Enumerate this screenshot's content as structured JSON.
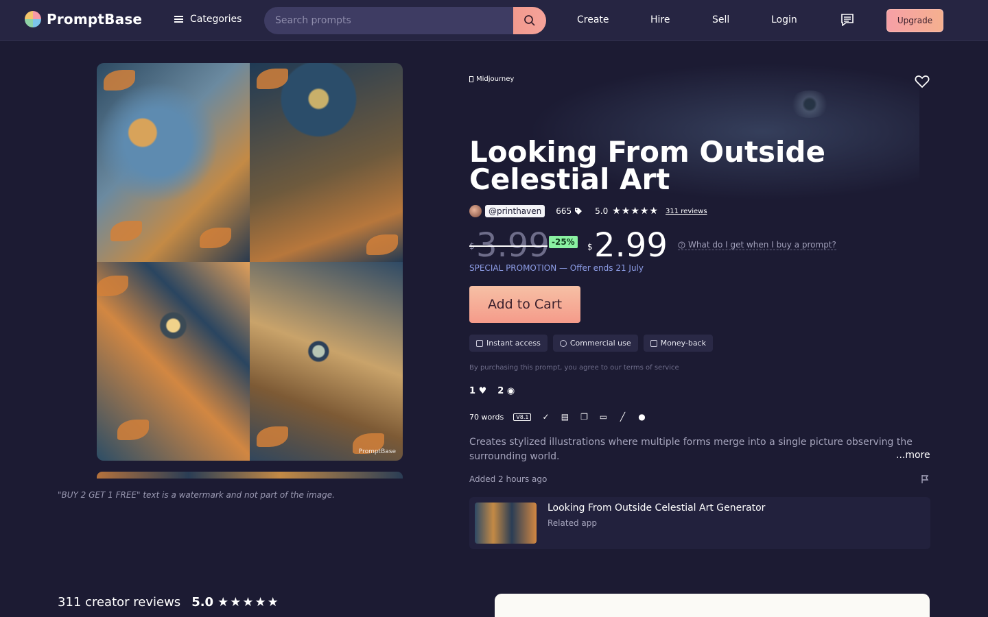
{
  "nav": {
    "brand": "PromptBase",
    "categories_label": "Categories",
    "search_placeholder": "Search prompts",
    "links": [
      "Create",
      "Hire",
      "Sell",
      "Login"
    ],
    "upgrade_label": "Upgrade"
  },
  "gallery": {
    "watermark": "PromptBase",
    "caption": "\"BUY 2 GET 1 FREE\" text is a watermark and not part of the image."
  },
  "product": {
    "model": "Midjourney",
    "title": "Looking From Outside Celestial Art",
    "seller": "@printhaven",
    "sales": "665",
    "rating": "5.0",
    "stars": "★★★★★",
    "reviews_link": "311 reviews",
    "old_currency": "$",
    "old_price": "3.99",
    "discount": "-25%",
    "currency": "$",
    "price": "2.99",
    "what_link": "What do I get when I buy a prompt?",
    "promo": "SPECIAL PROMOTION — Offer ends 21 July",
    "cart_label": "Add to Cart",
    "perks": [
      "Instant access",
      "Commercial use",
      "Money-back"
    ],
    "terms": "By purchasing this prompt, you agree to our terms of service",
    "likes": "1",
    "views": "2",
    "words": "70 words",
    "version": "V8.1",
    "description": "Creates stylized illustrations where multiple forms merge into a single picture observing the surrounding world.",
    "more_label": "...more",
    "added": "Added 2 hours ago"
  },
  "related": {
    "title": "Looking From Outside Celestial Art Generator",
    "subtitle": "Related app"
  },
  "reviews": {
    "count_label": "311 creator reviews",
    "score": "5.0",
    "stars": "★★★★★"
  },
  "colors": {
    "background": "#1c1b33",
    "nav": "#262542",
    "accent": "#f59b8a",
    "discount": "#8af1a2",
    "promo": "#8e9ee8"
  }
}
